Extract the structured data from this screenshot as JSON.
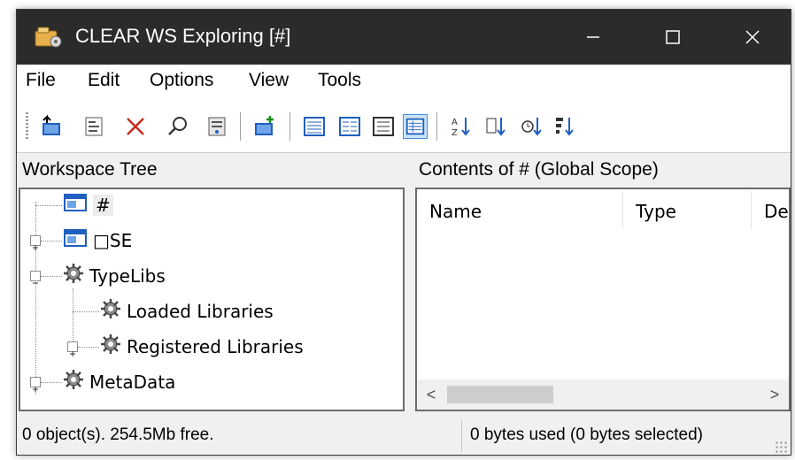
{
  "window": {
    "title": "CLEAR WS Exploring [#]",
    "controls": {
      "minimize": "—",
      "maximize": "☐",
      "close": "✕"
    }
  },
  "menu": [
    "File",
    "Edit",
    "Options",
    "View",
    "Tools"
  ],
  "toolbar": {
    "buttons": [
      "up-folder-icon",
      "properties-icon",
      "delete-icon",
      "find-icon",
      "object-browser-icon",
      "new-namespace-icon",
      "large-icons-view-icon",
      "small-icons-view-icon",
      "list-view-icon",
      "details-view-icon",
      "sort-by-name-icon",
      "sort-by-type-icon",
      "sort-by-date-icon",
      "sort-by-size-icon"
    ],
    "selected": "details-view-icon"
  },
  "left_pane": {
    "header": "Workspace Tree",
    "tree": [
      {
        "label": "#",
        "icon": "namespace-icon",
        "level": 0,
        "expander": "none",
        "selected": true
      },
      {
        "label": "□SE",
        "icon": "namespace-icon",
        "level": 0,
        "expander": "plus"
      },
      {
        "label": "TypeLibs",
        "icon": "gear-icon",
        "level": 0,
        "expander": "minus"
      },
      {
        "label": "Loaded Libraries",
        "icon": "gear-icon",
        "level": 1,
        "expander": "none"
      },
      {
        "label": "Registered Libraries",
        "icon": "gear-icon",
        "level": 1,
        "expander": "plus"
      },
      {
        "label": "MetaData",
        "icon": "gear-icon",
        "level": 0,
        "expander": "plus"
      }
    ]
  },
  "right_pane": {
    "header": "Contents of # (Global Scope)",
    "columns": [
      "Name",
      "Type",
      "De"
    ],
    "scroll_left": "<",
    "scroll_right": ">"
  },
  "status": {
    "left": "0 object(s). 254.5Mb free.",
    "right": "0 bytes used (0 bytes selected)"
  },
  "colors": {
    "titlebar": "#2b2b2b",
    "selection": "#cce4f7",
    "selection_border": "#3d8ee6",
    "icon_blue": "#1f5fbf",
    "icon_gear": "#5a5a5a",
    "delete_red": "#c42b1c"
  }
}
